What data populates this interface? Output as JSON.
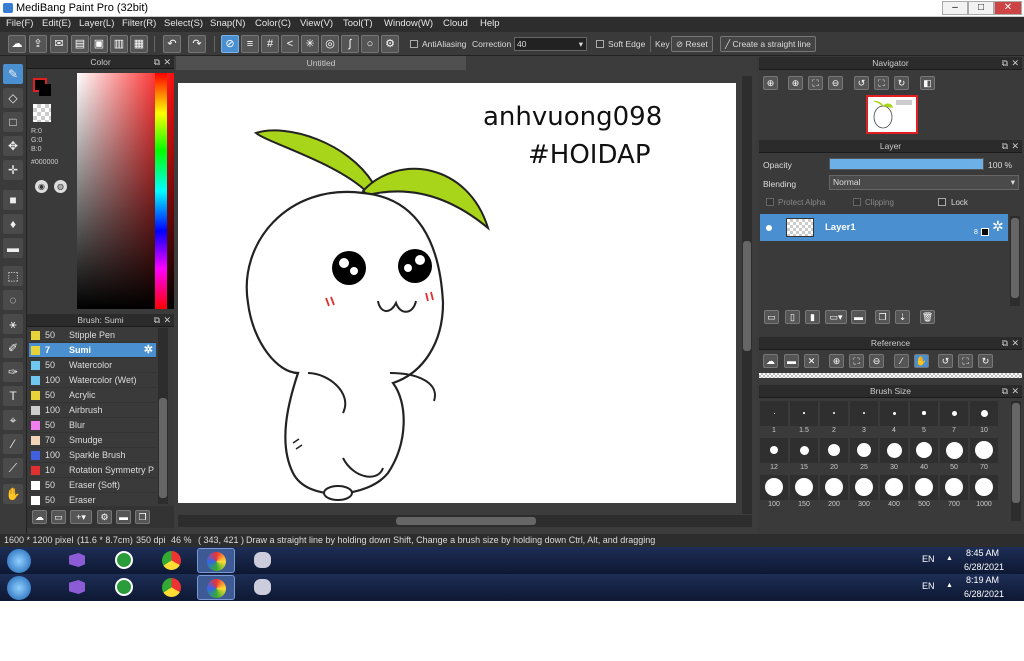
{
  "window": {
    "title": "MediBang Paint Pro (32bit)",
    "min": "–",
    "max": "□",
    "close": "✕"
  },
  "menu": [
    "File(F)",
    "Edit(E)",
    "Layer(L)",
    "Filter(R)",
    "Select(S)",
    "Snap(N)",
    "Color(C)",
    "View(V)",
    "Tool(T)",
    "Window(W)",
    "Cloud",
    "Help"
  ],
  "toolbar": {
    "antialiasing_label": "AntiAliasing",
    "correction_label": "Correction",
    "correction_value": "40",
    "soft_edge_label": "Soft Edge",
    "key_label": "Key",
    "reset_label": "Reset",
    "straight_line_label": "Create a straight line"
  },
  "color_panel": {
    "title": "Color",
    "r": "R:0",
    "g": "G:0",
    "b": "B:0",
    "hex": "#000000"
  },
  "brush_panel": {
    "title": "Brush: Sumi",
    "items": [
      {
        "size": "50",
        "name": "Stipple Pen",
        "color": "#e6d33a"
      },
      {
        "size": "7",
        "name": "Sumi",
        "color": "#e6d33a"
      },
      {
        "size": "50",
        "name": "Watercolor",
        "color": "#6ec8f0"
      },
      {
        "size": "100",
        "name": "Watercolor (Wet)",
        "color": "#6ec8f0"
      },
      {
        "size": "50",
        "name": "Acrylic",
        "color": "#e6d33a"
      },
      {
        "size": "100",
        "name": "Airbrush",
        "color": "#cccccc"
      },
      {
        "size": "50",
        "name": "Blur",
        "color": "#f080f0"
      },
      {
        "size": "70",
        "name": "Smudge",
        "color": "#f3d3b8"
      },
      {
        "size": "100",
        "name": "Sparkle Brush",
        "color": "#4060e0"
      },
      {
        "size": "10",
        "name": "Rotation Symmetry P",
        "color": "#e03030"
      },
      {
        "size": "50",
        "name": "Eraser (Soft)",
        "color": "#ffffff"
      },
      {
        "size": "50",
        "name": "Eraser",
        "color": "#ffffff"
      }
    ]
  },
  "document": {
    "tab_title": "Untitled",
    "signature_line1": "anhvuong098",
    "signature_line2": "#HOIDAP"
  },
  "navigator": {
    "title": "Navigator"
  },
  "layer_panel": {
    "title": "Layer",
    "opacity_label": "Opacity",
    "opacity_value": "100 %",
    "opacity_level": 1.0,
    "blending_label": "Blending",
    "blending_value": "Normal",
    "protect_alpha": "Protect Alpha",
    "clipping": "Clipping",
    "lock": "Lock",
    "layer_name": "Layer1",
    "layer_bits": "8"
  },
  "reference_panel": {
    "title": "Reference"
  },
  "brush_size_panel": {
    "title": "Brush Size",
    "sizes": [
      "1",
      "1.5",
      "2",
      "3",
      "4",
      "5",
      "7",
      "10",
      "12",
      "15",
      "20",
      "25",
      "30",
      "40",
      "50",
      "70",
      "100",
      "150",
      "200",
      "300",
      "400",
      "500",
      "700",
      "1000"
    ]
  },
  "status": {
    "dimensions": "1600 * 1200 pixel",
    "physical": "(11.6 * 8.7cm)",
    "dpi": "350 dpi",
    "zoom": "46 %",
    "cursor": "( 343, 421 )",
    "hint": "Draw a straight line by holding down Shift, Change a brush size by holding down Ctrl, Alt, and dragging"
  },
  "taskbar": [
    {
      "lang": "EN",
      "time": "8:45 AM",
      "date": "6/28/2021"
    },
    {
      "lang": "EN",
      "time": "8:19 AM",
      "date": "6/28/2021"
    }
  ]
}
